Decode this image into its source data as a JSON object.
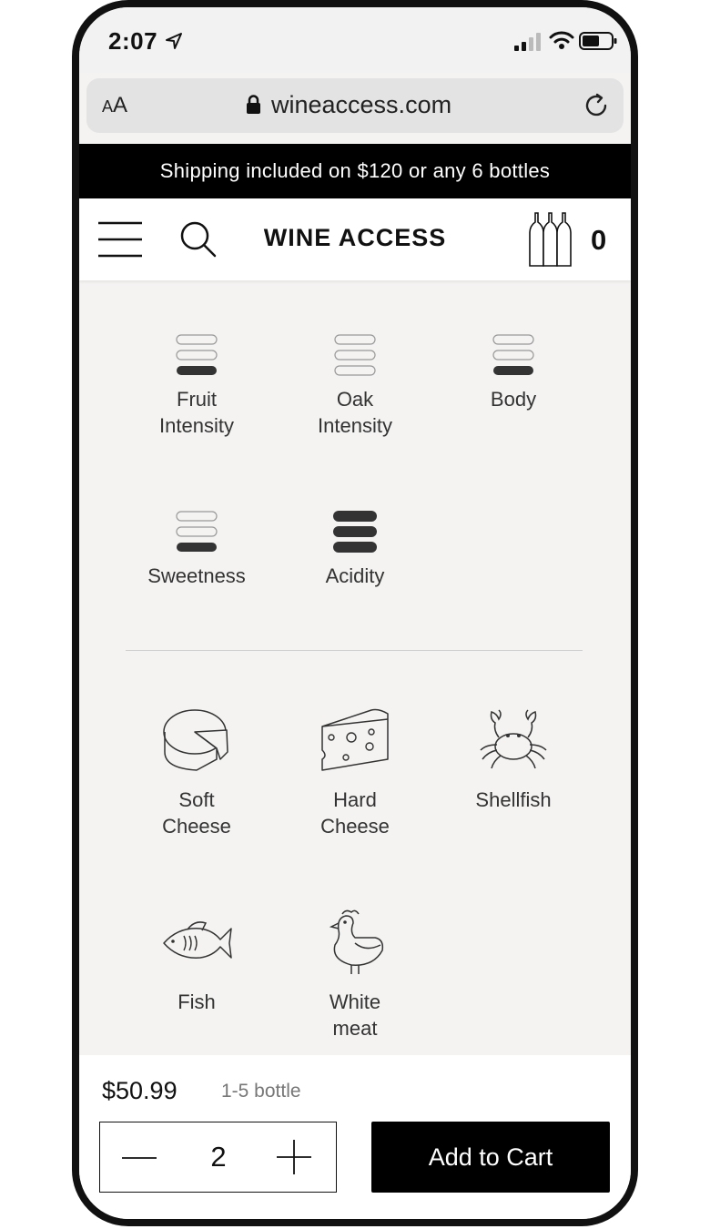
{
  "status_bar": {
    "time": "2:07"
  },
  "browser": {
    "text_size_label_small": "A",
    "text_size_label_large": "A",
    "url": "wineaccess.com"
  },
  "banner": {
    "text": "Shipping included on $120 or any 6 bottles"
  },
  "header": {
    "brand": "WINE ACCESS",
    "cart_count": "0"
  },
  "attributes": [
    {
      "label_line1": "Fruit",
      "label_line2": "Intensity",
      "level": 1,
      "max": 3
    },
    {
      "label_line1": "Oak",
      "label_line2": "Intensity",
      "level": 0,
      "max": 3
    },
    {
      "label_line1": "Body",
      "label_line2": "",
      "level": 1,
      "max": 3
    },
    {
      "label_line1": "Sweetness",
      "label_line2": "",
      "level": 1,
      "max": 3
    },
    {
      "label_line1": "Acidity",
      "label_line2": "",
      "level": 3,
      "max": 3
    }
  ],
  "pairings": [
    {
      "label_line1": "Soft",
      "label_line2": "Cheese",
      "icon": "soft-cheese-icon"
    },
    {
      "label_line1": "Hard",
      "label_line2": "Cheese",
      "icon": "hard-cheese-icon"
    },
    {
      "label_line1": "Shellfish",
      "label_line2": "",
      "icon": "crab-icon"
    },
    {
      "label_line1": "Fish",
      "label_line2": "",
      "icon": "fish-icon"
    },
    {
      "label_line1": "White",
      "label_line2": "meat",
      "icon": "chicken-icon"
    }
  ],
  "purchase": {
    "price": "$50.99",
    "price_note": "1-5 bottle",
    "quantity": "2",
    "add_to_cart_label": "Add to Cart"
  }
}
